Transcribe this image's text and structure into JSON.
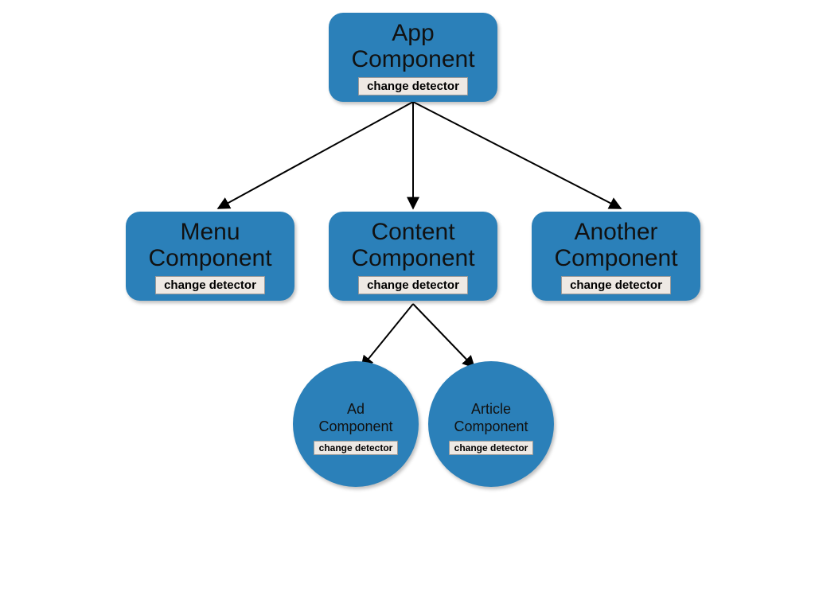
{
  "colors": {
    "node_fill": "#2b80b9",
    "badge_bg": "#eee9e4"
  },
  "badge": "change detector",
  "nodes": {
    "root": {
      "line1": "App",
      "line2": "Component"
    },
    "menu": {
      "line1": "Menu",
      "line2": "Component"
    },
    "content": {
      "line1": "Content",
      "line2": "Component"
    },
    "another": {
      "line1": "Another",
      "line2": "Component"
    },
    "ad": {
      "line1": "Ad",
      "line2": "Component"
    },
    "article": {
      "line1": "Article",
      "line2": "Component"
    }
  },
  "edges": [
    [
      "root",
      "menu"
    ],
    [
      "root",
      "content"
    ],
    [
      "root",
      "another"
    ],
    [
      "content",
      "ad"
    ],
    [
      "content",
      "article"
    ]
  ]
}
